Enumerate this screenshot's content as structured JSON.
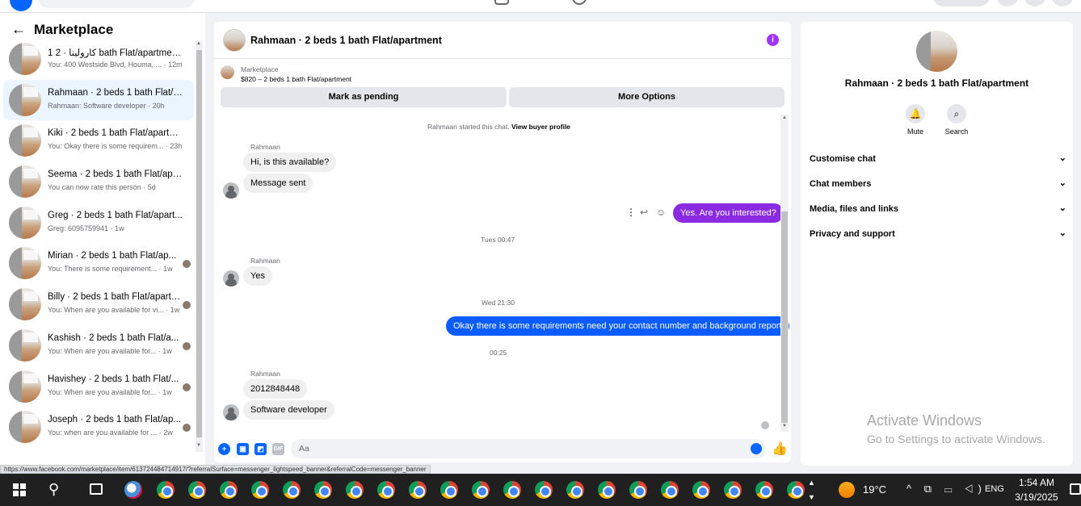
{
  "sidebar": {
    "back_icon": "arrow-left-icon",
    "title": "Marketplace",
    "conversations": [
      {
        "name": "كارولينا · 2 1 bath Flat/apartment ...",
        "preview": "You: 400 Westside Blvd, Houma, ... · 12m",
        "active": false
      },
      {
        "name": "Rahmaan · 2 beds 1 bath Flat/ap...",
        "preview": "Rahmaan: Software developer · 20h",
        "active": true
      },
      {
        "name": "Kiki · 2 beds 1 bath Flat/apartm...",
        "preview": "You: Okay there is some requirem... · 23h",
        "active": false
      },
      {
        "name": "Seema · 2 beds 1 bath Flat/apart...",
        "preview": "You can now rate this person · 5d",
        "active": false
      },
      {
        "name": "Greg · 2 beds 1 bath Flat/apart...",
        "preview": "Greg: 6095759941 · 1w",
        "active": false
      },
      {
        "name": "Mirian · 2 beds 1 bath Flat/ap...",
        "preview": "You: There is some requirement... · 1w",
        "active": false
      },
      {
        "name": "Billy · 2 beds 1 bath Flat/apartm...",
        "preview": "You: When are you available for vi... · 1w",
        "active": false
      },
      {
        "name": "Kashish · 2 beds 1 bath Flat/a...",
        "preview": "You: When are you available for... · 1w",
        "active": false
      },
      {
        "name": "Havishey · 2 beds 1 bath Flat/...",
        "preview": "You: When are you available for... · 1w",
        "active": false
      },
      {
        "name": "Joseph · 2 beds 1 bath Flat/ap...",
        "preview": "You: when are you available for ... · 2w",
        "active": false
      }
    ]
  },
  "chat": {
    "title": "Rahmaan · 2 beds 1 bath Flat/apartment",
    "info_icon": "info-icon",
    "listing_source": "Marketplace",
    "listing_price": "$820 – 2 beds 1 bath Flat/apartment",
    "mark_pending_label": "Mark as pending",
    "more_options_label": "More Options",
    "started_text": "Rahmaan started this chat.",
    "view_profile_link": "View buyer profile",
    "sender_name": "Rahmaan",
    "msg1": "Hi, is this available?",
    "msg2": "Message sent",
    "msg3": "Yes. Are you interested?",
    "ts1": "Tues 00:47",
    "msg4": "Yes",
    "ts2": "Wed 21:30",
    "msg5": "Okay there is some requirements need your contact number and background report",
    "ts3": "00:25",
    "msg6": "2012848448",
    "msg7": "Software developer",
    "composer_placeholder": "Aa"
  },
  "details": {
    "title": "Rahmaan · 2 beds 1 bath Flat/apartment",
    "mute_label": "Mute",
    "search_label": "Search",
    "sections": [
      "Customise chat",
      "Chat members",
      "Media, files and links",
      "Privacy and support"
    ],
    "watermark_title": "Activate Windows",
    "watermark_sub": "Go to Settings to activate Windows."
  },
  "status_url": "https://www.facebook.com/marketplace/item/613724484714917/?referralSurface=messenger_lightspeed_banner&referralCode=messenger_banner",
  "taskbar": {
    "temperature": "19°C",
    "language": "ENG",
    "time": "1:54 AM",
    "date": "3/19/2025"
  }
}
